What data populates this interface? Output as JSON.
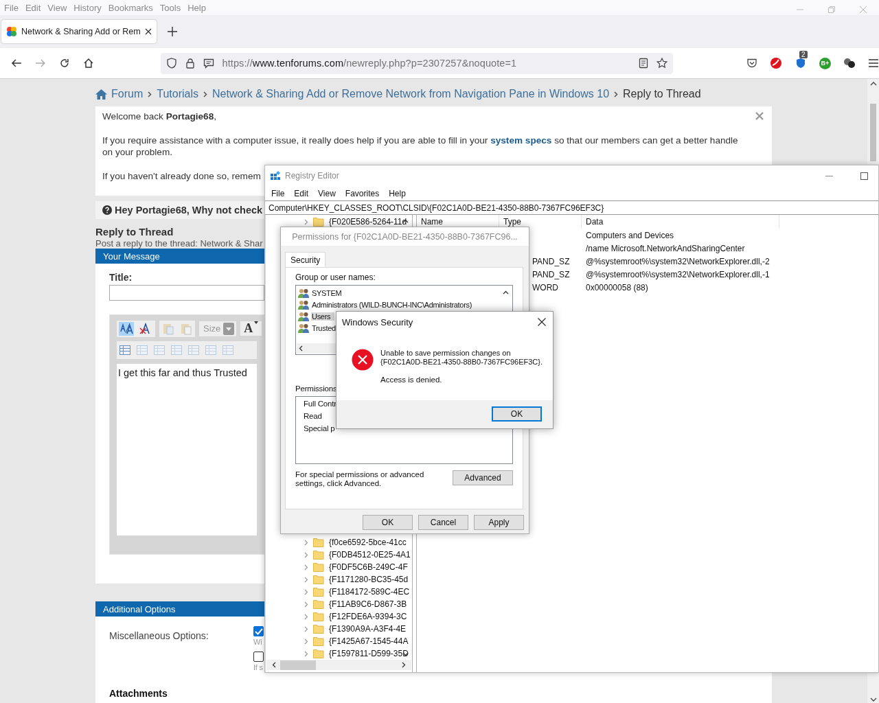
{
  "browser": {
    "menu": [
      "File",
      "Edit",
      "View",
      "History",
      "Bookmarks",
      "Tools",
      "Help"
    ],
    "tabs": [
      {
        "title": "Network & Sharing Add or Rem",
        "selected": true
      }
    ],
    "url": {
      "scheme": "https://",
      "domain": "www.tenforums.com",
      "path": "/newreply.php?p=2307257&noquote=1"
    },
    "extension_badge": "2",
    "extension_label": "B+"
  },
  "breadcrumb": [
    {
      "label": "Forum",
      "kind": "home"
    },
    {
      "label": "Tutorials",
      "kind": "link"
    },
    {
      "label": "Network & Sharing Add or Remove Network from Navigation Pane in Windows 10",
      "kind": "link"
    },
    {
      "label": "Reply to Thread",
      "kind": "current"
    }
  ],
  "welcome": {
    "greeting": "Welcome back **Portagie68**,",
    "specs_before": "If you require assistance with a computer issue, it really does help if you are able to fill in your",
    "specs_link": "system specs",
    "specs_after": "so that our members can get a better handle on your problem.",
    "reminder": "If you haven't already done so, remem"
  },
  "notice": "Hey Portagie68, Why not check",
  "reply": {
    "heading": "Reply to Thread",
    "subheading": "Post a reply to the thread: Network & Shar",
    "message_header": "Your Message",
    "title_label": "Title:",
    "editor": {
      "size_placeholder": "Size",
      "font_button": "A",
      "text": "I get this far and thus Trusted"
    }
  },
  "additional": {
    "header": "Additional Options",
    "label": "Miscellaneous Options:",
    "options": [
      {
        "checked": true,
        "text": "Wi"
      },
      {
        "checked": false,
        "text": "If s"
      }
    ]
  },
  "attachments": "Attachments",
  "regedit": {
    "title": "Registry Editor",
    "menu": [
      "File",
      "Edit",
      "View",
      "Favorites",
      "Help"
    ],
    "address": "Computer\\HKEY_CLASSES_ROOT\\CLSID\\{F02C1A0D-BE21-4350-88B0-7367FC96EF3C}",
    "columns": [
      "Name",
      "Type",
      "Data"
    ],
    "values": [
      {
        "data": "Computers and Devices"
      },
      {
        "data": "/name Microsoft.NetworkAndSharingCenter"
      },
      {
        "type": "PAND_SZ",
        "data": "@%systemroot%\\system32\\NetworkExplorer.dll,-2"
      },
      {
        "type": "PAND_SZ",
        "data": "@%systemroot%\\system32\\NetworkExplorer.dll,-1"
      },
      {
        "type": "WORD",
        "data": "0x00000058 (88)"
      }
    ],
    "tree_top": "{F020E586-5264-11d",
    "tree": [
      "{f0ce6592-5bce-41cc",
      "{F0DB4512-0E25-4A1",
      "{F0DF5C6B-249C-4F",
      "{F1171280-BC35-45d",
      "{F1184172-589C-4EC",
      "{F11AB9C6-D867-3B",
      "{F12FDE6A-9394-3C",
      "{F1390A9A-A3F4-4E",
      "{F1425A67-1545-44A",
      "{F1597811-D599-35D"
    ]
  },
  "permissions": {
    "title": "Permissions for {F02C1A0D-BE21-4350-88B0-7367FC96...",
    "tabs": [
      {
        "label": "Security",
        "selected": true
      }
    ],
    "group_label": "Group or user names:",
    "users": [
      {
        "name": "SYSTEM",
        "selected": false
      },
      {
        "name": "Administrators (WILD-BUNCH-INC\\Administrators)",
        "selected": false
      },
      {
        "name": "Users",
        "selected": true
      },
      {
        "name": "Trusted",
        "selected": false
      }
    ],
    "permissions_label": "Permissions",
    "permissions": [
      "Full Contr",
      "Read",
      "Special p"
    ],
    "advanced_note": "For special permissions or advanced settings, click Advanced.",
    "advanced_button": "Advanced",
    "buttons": [
      "OK",
      "Cancel",
      "Apply"
    ]
  },
  "security": {
    "title": "Windows Security",
    "message": "Unable to save permission changes on {F02C1A0D-BE21-4350-88B0-7367FC96EF3C}.",
    "detail": "Access is denied.",
    "button": "OK"
  }
}
